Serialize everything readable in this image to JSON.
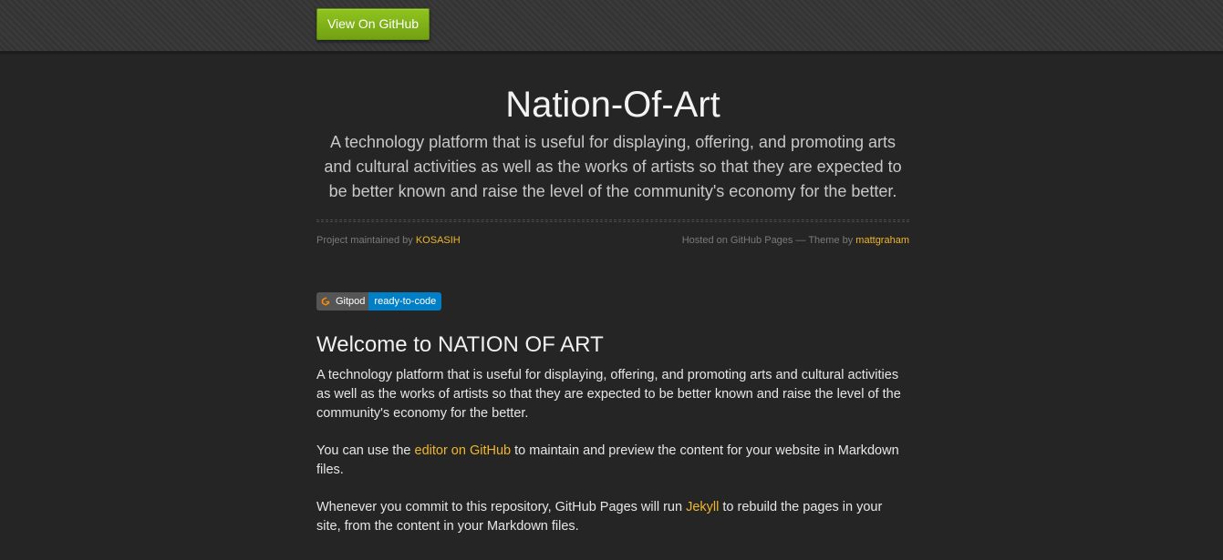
{
  "header": {
    "github_button_label": "View On GitHub"
  },
  "project": {
    "title": "Nation-Of-Art",
    "tagline": "A technology platform that is useful for displaying, offering, and promoting arts and cultural activities as well as the works of artists so that they are expected to be better known and raise the level of the community's economy for the better."
  },
  "credits": {
    "maintained_prefix": "Project maintained by ",
    "maintainer": "KOSASIH",
    "hosted_text": "Hosted on GitHub Pages — Theme by ",
    "theme_author": "mattgraham"
  },
  "badge": {
    "left_label": "Gitpod",
    "right_label": "ready-to-code",
    "icon": "gitpod-icon",
    "left_color": "#555555",
    "right_color": "#007ec6"
  },
  "content": {
    "heading": "Welcome to NATION OF ART",
    "paragraph1": "A technology platform that is useful for displaying, offering, and promoting arts and cultural activities as well as the works of artists so that they are expected to be better known and raise the level of the community's economy for the better.",
    "paragraph2_before": "You can use the ",
    "paragraph2_link": "editor on GitHub",
    "paragraph2_after": " to maintain and preview the content for your website in Markdown files.",
    "paragraph3_before": "Whenever you commit to this repository, GitHub Pages will run ",
    "paragraph3_link": "Jekyll",
    "paragraph3_after": " to rebuild the pages in your site, from the content in your Markdown files."
  },
  "colors": {
    "background": "#252525",
    "accent_link": "#f0b52b",
    "button_green": "#83b41a"
  }
}
